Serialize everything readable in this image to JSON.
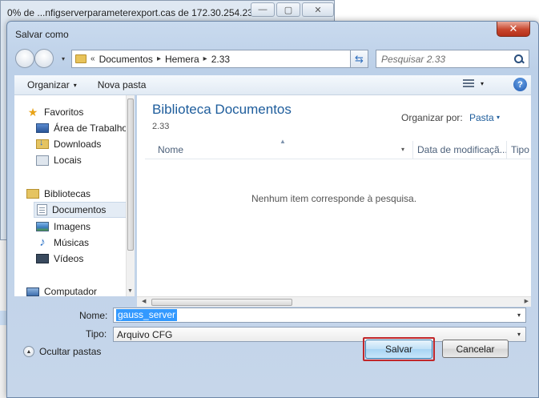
{
  "background_window": {
    "title": "0% de ...nfigserverparameterexport.cas de 172.30.254.23...",
    "minimize": "—",
    "maximize": "▢",
    "close": "✕"
  },
  "dialog": {
    "title": "Salvar como",
    "close": "✕"
  },
  "address_bar": {
    "prefix": "«",
    "crumbs": [
      "Documentos",
      "Hemera",
      "2.33"
    ],
    "separator": "▸",
    "dropdown": "▾"
  },
  "search": {
    "placeholder": "Pesquisar 2.33"
  },
  "toolbar": {
    "organize": "Organizar",
    "new_folder": "Nova pasta",
    "dropdown": "▾",
    "help": "?"
  },
  "nav": {
    "favorites": "Favoritos",
    "desktop": "Área de Trabalho",
    "downloads": "Downloads",
    "locals": "Locais",
    "libraries": "Bibliotecas",
    "documents": "Documentos",
    "images": "Imagens",
    "music": "Músicas",
    "videos": "Vídeos",
    "computer": "Computador"
  },
  "content": {
    "library_title": "Biblioteca Documentos",
    "library_sub": "2.33",
    "organize_by_label": "Organizar por:",
    "organize_by_value": "Pasta",
    "col_name": "Nome",
    "col_date": "Data de modificaçã...",
    "col_type": "Tipo",
    "empty_message": "Nenhum item corresponde à pesquisa."
  },
  "form": {
    "name_label": "Nome:",
    "name_value": "gauss_server",
    "type_label": "Tipo:",
    "type_value": "Arquivo CFG"
  },
  "footer": {
    "hide_folders": "Ocultar pastas",
    "save": "Salvar",
    "cancel": "Cancelar"
  },
  "colors": {
    "link_blue": "#1e5d9c",
    "selection": "#3399ff",
    "highlight_border": "#c0262a"
  }
}
